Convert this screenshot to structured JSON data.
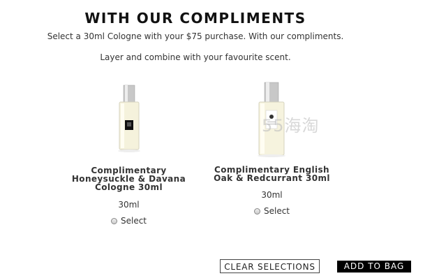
{
  "header": {
    "title": "WITH OUR COMPLIMENTS",
    "subtitle": "Select a 30ml Cologne with your $75 purchase. With our compliments.",
    "subtitle2": "Layer and combine with your favourite scent."
  },
  "products": [
    {
      "name_line1": "Complimentary",
      "name_line2": "Honeysuckle & Davana",
      "name_line3": "Cologne 30ml",
      "size": "30ml",
      "select_label": "Select",
      "bottle_icon": "cologne-bottle-icon"
    },
    {
      "name_line1": "Complimentary English",
      "name_line2": "Oak & Redcurrant 30ml",
      "size": "30ml",
      "select_label": "Select",
      "bottle_icon": "cologne-bottle-icon"
    }
  ],
  "watermark": "55海淘",
  "actions": {
    "clear_label": "CLEAR SELECTIONS",
    "add_label": "ADD TO BAG"
  }
}
